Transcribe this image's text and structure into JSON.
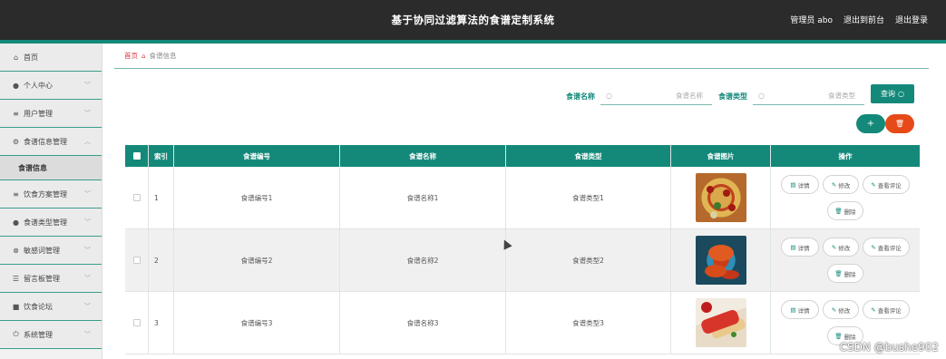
{
  "header": {
    "title": "基于协同过滤算法的食谱定制系统",
    "user_label": "管理员 abo",
    "back_label": "退出到前台",
    "logout_label": "退出登录"
  },
  "sidebar": {
    "items": [
      {
        "label": "首页",
        "icon": "home-icon"
      },
      {
        "label": "个人中心",
        "icon": "user-icon"
      },
      {
        "label": "用户管理",
        "icon": "list-icon"
      },
      {
        "label": "食谱信息管理",
        "icon": "settings-icon"
      },
      {
        "label": "饮食方案管理",
        "icon": "list-icon"
      },
      {
        "label": "食谱类型管理",
        "icon": "location-icon"
      },
      {
        "label": "敏感词管理",
        "icon": "block-icon"
      },
      {
        "label": "留言板管理",
        "icon": "sliders-icon"
      },
      {
        "label": "饮食论坛",
        "icon": "chat-icon"
      },
      {
        "label": "系统管理",
        "icon": "power-icon"
      }
    ],
    "active_sub": "食谱信息"
  },
  "breadcrumb": {
    "home": "首页",
    "current": "食谱信息"
  },
  "search": {
    "name_label": "食谱名称",
    "name_placeholder": "食谱名称",
    "type_label": "食谱类型",
    "type_placeholder": "食谱类型",
    "query_label": "查询"
  },
  "actions": {
    "add_label": "+",
    "delete_label": "🗑"
  },
  "table": {
    "headers": {
      "index": "索引",
      "code": "食谱编号",
      "name": "食谱名称",
      "type": "食谱类型",
      "image": "食谱图片",
      "ops": "操作"
    },
    "rows": [
      {
        "index": "1",
        "code": "食谱编号1",
        "name": "食谱名称1",
        "type": "食谱类型1",
        "image": "pizza"
      },
      {
        "index": "2",
        "code": "食谱编号2",
        "name": "食谱名称2",
        "type": "食谱类型2",
        "image": "crab"
      },
      {
        "index": "3",
        "code": "食谱编号3",
        "name": "食谱名称3",
        "type": "食谱类型3",
        "image": "roll"
      }
    ],
    "op_labels": {
      "detail": "详情",
      "edit": "修改",
      "review": "查看评论",
      "delete": "删除"
    }
  },
  "watermark": "CSDN @bushe902",
  "colors": {
    "accent": "#14897a",
    "header_bg": "#2b2b2b",
    "danger": "#e64a19",
    "breadcrumb_home": "#d9363e"
  }
}
